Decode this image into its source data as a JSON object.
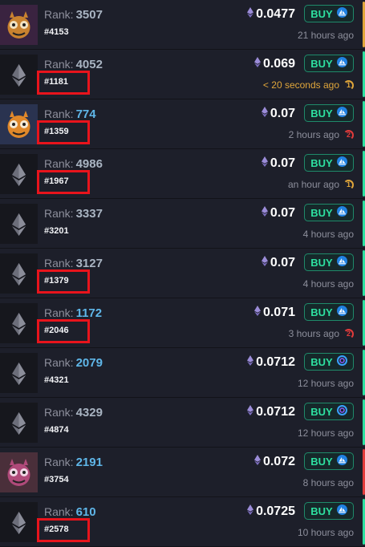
{
  "colors": {
    "accent_green": "#2ee0a0",
    "accent_yellow": "#e0a63b",
    "accent_red": "#e23b3b",
    "highlight_red": "#e8141c",
    "rank_blue": "#5fb6e8",
    "rank_gray": "#a9b4c2"
  },
  "buy_label": "BUY",
  "rank_prefix": "Rank:",
  "listings": [
    {
      "thumb": "monster-art-1",
      "rank": "3507",
      "rank_color": "gray",
      "token": "#4153",
      "price": "0.0477",
      "time": "21 hours ago",
      "time_style": "normal",
      "counter": null,
      "counter_color": null,
      "accent": "yellow",
      "market_icon": "wave-icon",
      "highlight": false
    },
    {
      "thumb": "ethereum-icon",
      "rank": "4052",
      "rank_color": "gray",
      "token": "#1181",
      "price": "0.069",
      "time": "< 20 seconds ago",
      "time_style": "fresh",
      "counter": "1",
      "counter_color": "yellow",
      "accent": "green",
      "market_icon": "wave-icon",
      "highlight": true
    },
    {
      "thumb": "monster-art-2",
      "rank": "774",
      "rank_color": "blue",
      "token": "#1359",
      "price": "0.07",
      "time": "2 hours ago",
      "time_style": "normal",
      "counter": "2",
      "counter_color": "red",
      "accent": "green",
      "market_icon": "wave-icon",
      "highlight": true
    },
    {
      "thumb": "ethereum-icon",
      "rank": "4986",
      "rank_color": "gray",
      "token": "#1967",
      "price": "0.07",
      "time": "an hour ago",
      "time_style": "normal",
      "counter": "1",
      "counter_color": "yellow",
      "accent": "green",
      "market_icon": "wave-icon",
      "highlight": true
    },
    {
      "thumb": "ethereum-icon",
      "rank": "3337",
      "rank_color": "gray",
      "token": "#3201",
      "price": "0.07",
      "time": "4 hours ago",
      "time_style": "normal",
      "counter": null,
      "counter_color": null,
      "accent": "green",
      "market_icon": "wave-icon",
      "highlight": false
    },
    {
      "thumb": "ethereum-icon",
      "rank": "3127",
      "rank_color": "gray",
      "token": "#1379",
      "price": "0.07",
      "time": "4 hours ago",
      "time_style": "normal",
      "counter": null,
      "counter_color": null,
      "accent": "green",
      "market_icon": "wave-icon",
      "highlight": true
    },
    {
      "thumb": "ethereum-icon",
      "rank": "1172",
      "rank_color": "blue",
      "token": "#2046",
      "price": "0.071",
      "time": "3 hours ago",
      "time_style": "normal",
      "counter": "2",
      "counter_color": "red",
      "accent": "green",
      "market_icon": "wave-icon",
      "highlight": true
    },
    {
      "thumb": "ethereum-icon",
      "rank": "2079",
      "rank_color": "blue",
      "token": "#4321",
      "price": "0.0712",
      "time": "12 hours ago",
      "time_style": "normal",
      "counter": null,
      "counter_color": null,
      "accent": "green",
      "market_icon": "ring-icon",
      "highlight": false
    },
    {
      "thumb": "ethereum-icon",
      "rank": "4329",
      "rank_color": "gray",
      "token": "#4874",
      "price": "0.0712",
      "time": "12 hours ago",
      "time_style": "normal",
      "counter": null,
      "counter_color": null,
      "accent": "green",
      "market_icon": "ring-icon",
      "highlight": false
    },
    {
      "thumb": "monster-art-3",
      "rank": "2191",
      "rank_color": "blue",
      "token": "#3754",
      "price": "0.072",
      "time": "8 hours ago",
      "time_style": "normal",
      "counter": null,
      "counter_color": null,
      "accent": "red",
      "market_icon": "wave-icon",
      "highlight": false
    },
    {
      "thumb": "ethereum-icon",
      "rank": "610",
      "rank_color": "blue",
      "token": "#2578",
      "price": "0.0725",
      "time": "10 hours ago",
      "time_style": "normal",
      "counter": null,
      "counter_color": null,
      "accent": "green",
      "market_icon": "wave-icon",
      "highlight": true
    }
  ]
}
